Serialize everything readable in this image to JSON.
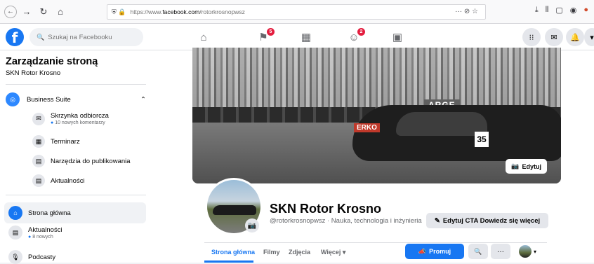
{
  "browser": {
    "url_prefix": "https://www.",
    "url_host": "facebook.com",
    "url_path": "/rotorkrosnopwsz",
    "url_menu": "··· ⊘ ☆"
  },
  "fb_header": {
    "logo": "f",
    "search_placeholder": "Szukaj na Facebooku",
    "badges": {
      "pages": "5",
      "groups": "2"
    }
  },
  "sidebar": {
    "title": "Zarządzanie stroną",
    "subtitle": "SKN Rotor Krosno",
    "business_suite": "Business Suite",
    "items": [
      {
        "label": "Skrzynka odbiorcza",
        "sub": "10 nowych komentarzy"
      },
      {
        "label": "Terminarz"
      },
      {
        "label": "Narzędzia do publikowania"
      },
      {
        "label": "Aktualności"
      }
    ],
    "nav": [
      {
        "label": "Strona główna"
      },
      {
        "label": "Aktualności",
        "sub": "8 nowych"
      },
      {
        "label": "Podcasty"
      }
    ]
  },
  "cover": {
    "edit_label": "Edytuj",
    "banner_arge": "ARGE",
    "banner_erko": "ERKO",
    "car_number": "35"
  },
  "profile": {
    "name": "SKN Rotor Krosno",
    "handle": "@rotorkrosnopwsz · Nauka, technologia i inżynieria",
    "cta_label": "Edytuj CTA Dowiedz się więcej"
  },
  "tabs": [
    {
      "label": "Strona główna",
      "active": true
    },
    {
      "label": "Filmy"
    },
    {
      "label": "Zdjęcia"
    },
    {
      "label": "Więcej ▾"
    }
  ],
  "actions": {
    "promote_label": "Promuj",
    "search_icon": "🔍",
    "more_label": "···"
  },
  "colors": {
    "fb_blue": "#1877f2",
    "badge_red": "#e41e3f"
  }
}
